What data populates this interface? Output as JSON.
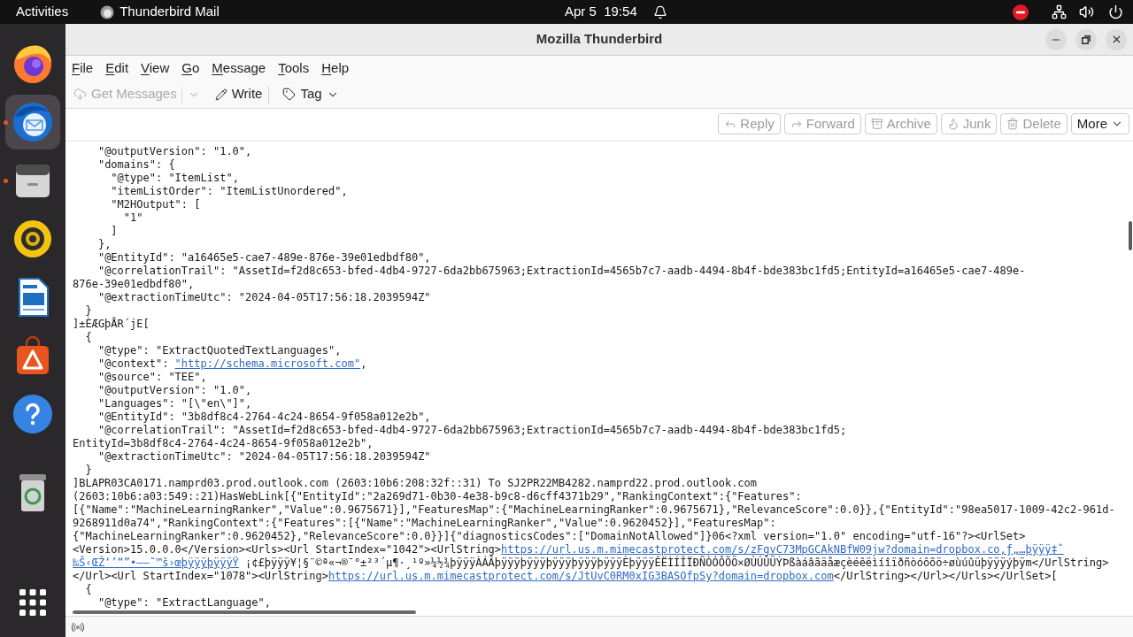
{
  "top_bar": {
    "activities": "Activities",
    "app_menu": "Thunderbird Mail",
    "clock": "Apr 5  19:54"
  },
  "dock": {
    "items": [
      {
        "kind": "browser",
        "selected": false,
        "running": false
      },
      {
        "kind": "mail",
        "selected": true,
        "running": true
      },
      {
        "kind": "files",
        "selected": false,
        "running": true
      },
      {
        "kind": "music",
        "selected": false,
        "running": false
      },
      {
        "kind": "writer",
        "selected": false,
        "running": false
      },
      {
        "kind": "store",
        "selected": false,
        "running": false
      },
      {
        "kind": "help",
        "selected": false,
        "running": false
      },
      {
        "kind": "trash",
        "selected": false,
        "running": false
      }
    ]
  },
  "window": {
    "title": "Mozilla Thunderbird"
  },
  "menu_bar": [
    "File",
    "Edit",
    "View",
    "Go",
    "Message",
    "Tools",
    "Help"
  ],
  "toolbar": [
    {
      "kind": "get",
      "label": "Get Messages",
      "disabled": true,
      "dropdown": true,
      "split": true
    },
    {
      "kind": "write",
      "label": "Write",
      "disabled": false,
      "dropdown": false
    },
    {
      "kind": "tag",
      "label": "Tag",
      "disabled": false,
      "dropdown": true,
      "split": false
    }
  ],
  "message_actions": [
    {
      "kind": "reply",
      "label": "Reply",
      "disabled": true
    },
    {
      "kind": "forward",
      "label": "Forward",
      "disabled": true
    },
    {
      "kind": "archive",
      "label": "Archive",
      "disabled": true
    },
    {
      "kind": "junk",
      "label": "Junk",
      "disabled": true
    },
    {
      "kind": "delete",
      "label": "Delete",
      "disabled": true
    },
    {
      "kind": "more",
      "label": "More",
      "disabled": false
    }
  ],
  "message_body": {
    "lines": [
      {
        "text": "    \"@outputVersion\": \"1.0\","
      },
      {
        "text": "    \"domains\": {"
      },
      {
        "text": "      \"@type\": \"ItemList\","
      },
      {
        "text": "      \"itemListOrder\": \"ItemListUnordered\","
      },
      {
        "text": "      \"M2HOutput\": ["
      },
      {
        "text": "        \"1\""
      },
      {
        "text": "      ]"
      },
      {
        "text": "    },"
      },
      {
        "text": "    \"@EntityId\": \"a16465e5-cae7-489e-876e-39e01edbdf80\","
      },
      {
        "text": "    \"@correlationTrail\": \"AssetId=f2d8c653-bfed-4db4-9727-6da2bb675963;ExtractionId=4565b7c7-aadb-4494-8b4f-bde383bc1fd5;EntityId=a16465e5-cae7-489e-"
      },
      {
        "text": "876e-39e01edbdf80\","
      },
      {
        "text": "    \"@extractionTimeUtc\": \"2024-04-05T17:56:18.2039594Z\""
      },
      {
        "text": "  }"
      },
      {
        "text": "]±ÈÆGþÅR´jE["
      },
      {
        "text": "  {"
      },
      {
        "text": "    \"@type\": \"ExtractQuotedTextLanguages\","
      },
      {
        "segments": [
          {
            "kind": "text",
            "text": "    \"@context\": "
          },
          {
            "kind": "link",
            "text": "\"http://schema.microsoft.com\""
          },
          {
            "kind": "text",
            "text": ","
          }
        ]
      },
      {
        "text": "    \"@source\": \"TEE\","
      },
      {
        "text": "    \"@outputVersion\": \"1.0\","
      },
      {
        "text": "    \"Languages\": \"[\\\"en\\\"]\","
      },
      {
        "text": "    \"@EntityId\": \"3b8df8c4-2764-4c24-8654-9f058a012e2b\","
      },
      {
        "text": "    \"@correlationTrail\": \"AssetId=f2d8c653-bfed-4db4-9727-6da2bb675963;ExtractionId=4565b7c7-aadb-4494-8b4f-bde383bc1fd5;"
      },
      {
        "text": "EntityId=3b8df8c4-2764-4c24-8654-9f058a012e2b\","
      },
      {
        "text": "    \"@extractionTimeUtc\": \"2024-04-05T17:56:18.2039594Z\""
      },
      {
        "text": "  }"
      },
      {
        "text": "]BLAPR03CA0171.namprd03.prod.outlook.com (2603:10b6:208:32f::31) To SJ2PR22MB4282.namprd22.prod.outlook.com"
      },
      {
        "text": "(2603:10b6:a03:549::21)HasWebLink[{\"EntityId\":\"2a269d71-0b30-4e38-b9c8-d6cff4371b29\",\"RankingContext\":{\"Features\":"
      },
      {
        "text": "[{\"Name\":\"MachineLearningRanker\",\"Value\":0.9675671}],\"FeaturesMap\":{\"MachineLearningRanker\":0.9675671},\"RelevanceScore\":0.0}},{\"EntityId\":\"98ea5017-1009-42c2-961d-"
      },
      {
        "text": "9268911d0a74\",\"RankingContext\":{\"Features\":[{\"Name\":\"MachineLearningRanker\",\"Value\":0.9620452}],\"FeaturesMap\":"
      },
      {
        "text": "{\"MachineLearningRanker\":0.9620452},\"RelevanceScore\":0.0}}]{\"diagnosticsCodes\":[\"DomainNotAllowed\"]}06<?xml version=\"1.0\" encoding=\"utf-16\"?><UrlSet>"
      },
      {
        "segments": [
          {
            "kind": "text",
            "text": "<Version>15.0.0.0</Version><Urls><Url StartIndex=\"1042\"><UrlString>"
          },
          {
            "kind": "link",
            "text": "https://url.us.m.mimecastprotect.com/s/zFgvC73MpGCAkNBfW09jw?domain=dropbox.co‚ƒ„…þÿÿÿ‡ˆ"
          }
        ]
      },
      {
        "segments": [
          {
            "kind": "link",
            "text": "‰Š‹ŒŽ‘’“”•–—˜™š›œþÿÿÿþÿÿÿŸ"
          },
          {
            "kind": "text",
            "text": " ¡¢£þÿÿÿ¥¦§¨©ª«¬®¯°±²³´µ¶·¸¹º»¼½¾þÿÿÿÀÁÂþÿÿÿþÿÿÿþÿÿÿþÿÿÿþÿÿÿÈþÿÿÿÊËÌÍÎÏÐÑÒÓÔÕÖ×ØÙÚÛÜÝÞßàáâãäåæçèéêëìíîïðñòóôõö÷øùúûüþÿÿÿýþÿm</UrlString>"
          }
        ]
      },
      {
        "segments": [
          {
            "kind": "text",
            "text": "</Url><Url StartIndex=\"1078\"><UrlString>"
          },
          {
            "kind": "link",
            "text": "https://url.us.m.mimecastprotect.com/s/JtUvC0RM0xIG3BASOfpSy?domain=dropbox.com"
          },
          {
            "kind": "text",
            "text": "</UrlString></Url></Urls></UrlSet>["
          }
        ]
      },
      {
        "text": "  {"
      },
      {
        "text": "    \"@type\": \"ExtractLanguage\","
      }
    ]
  }
}
